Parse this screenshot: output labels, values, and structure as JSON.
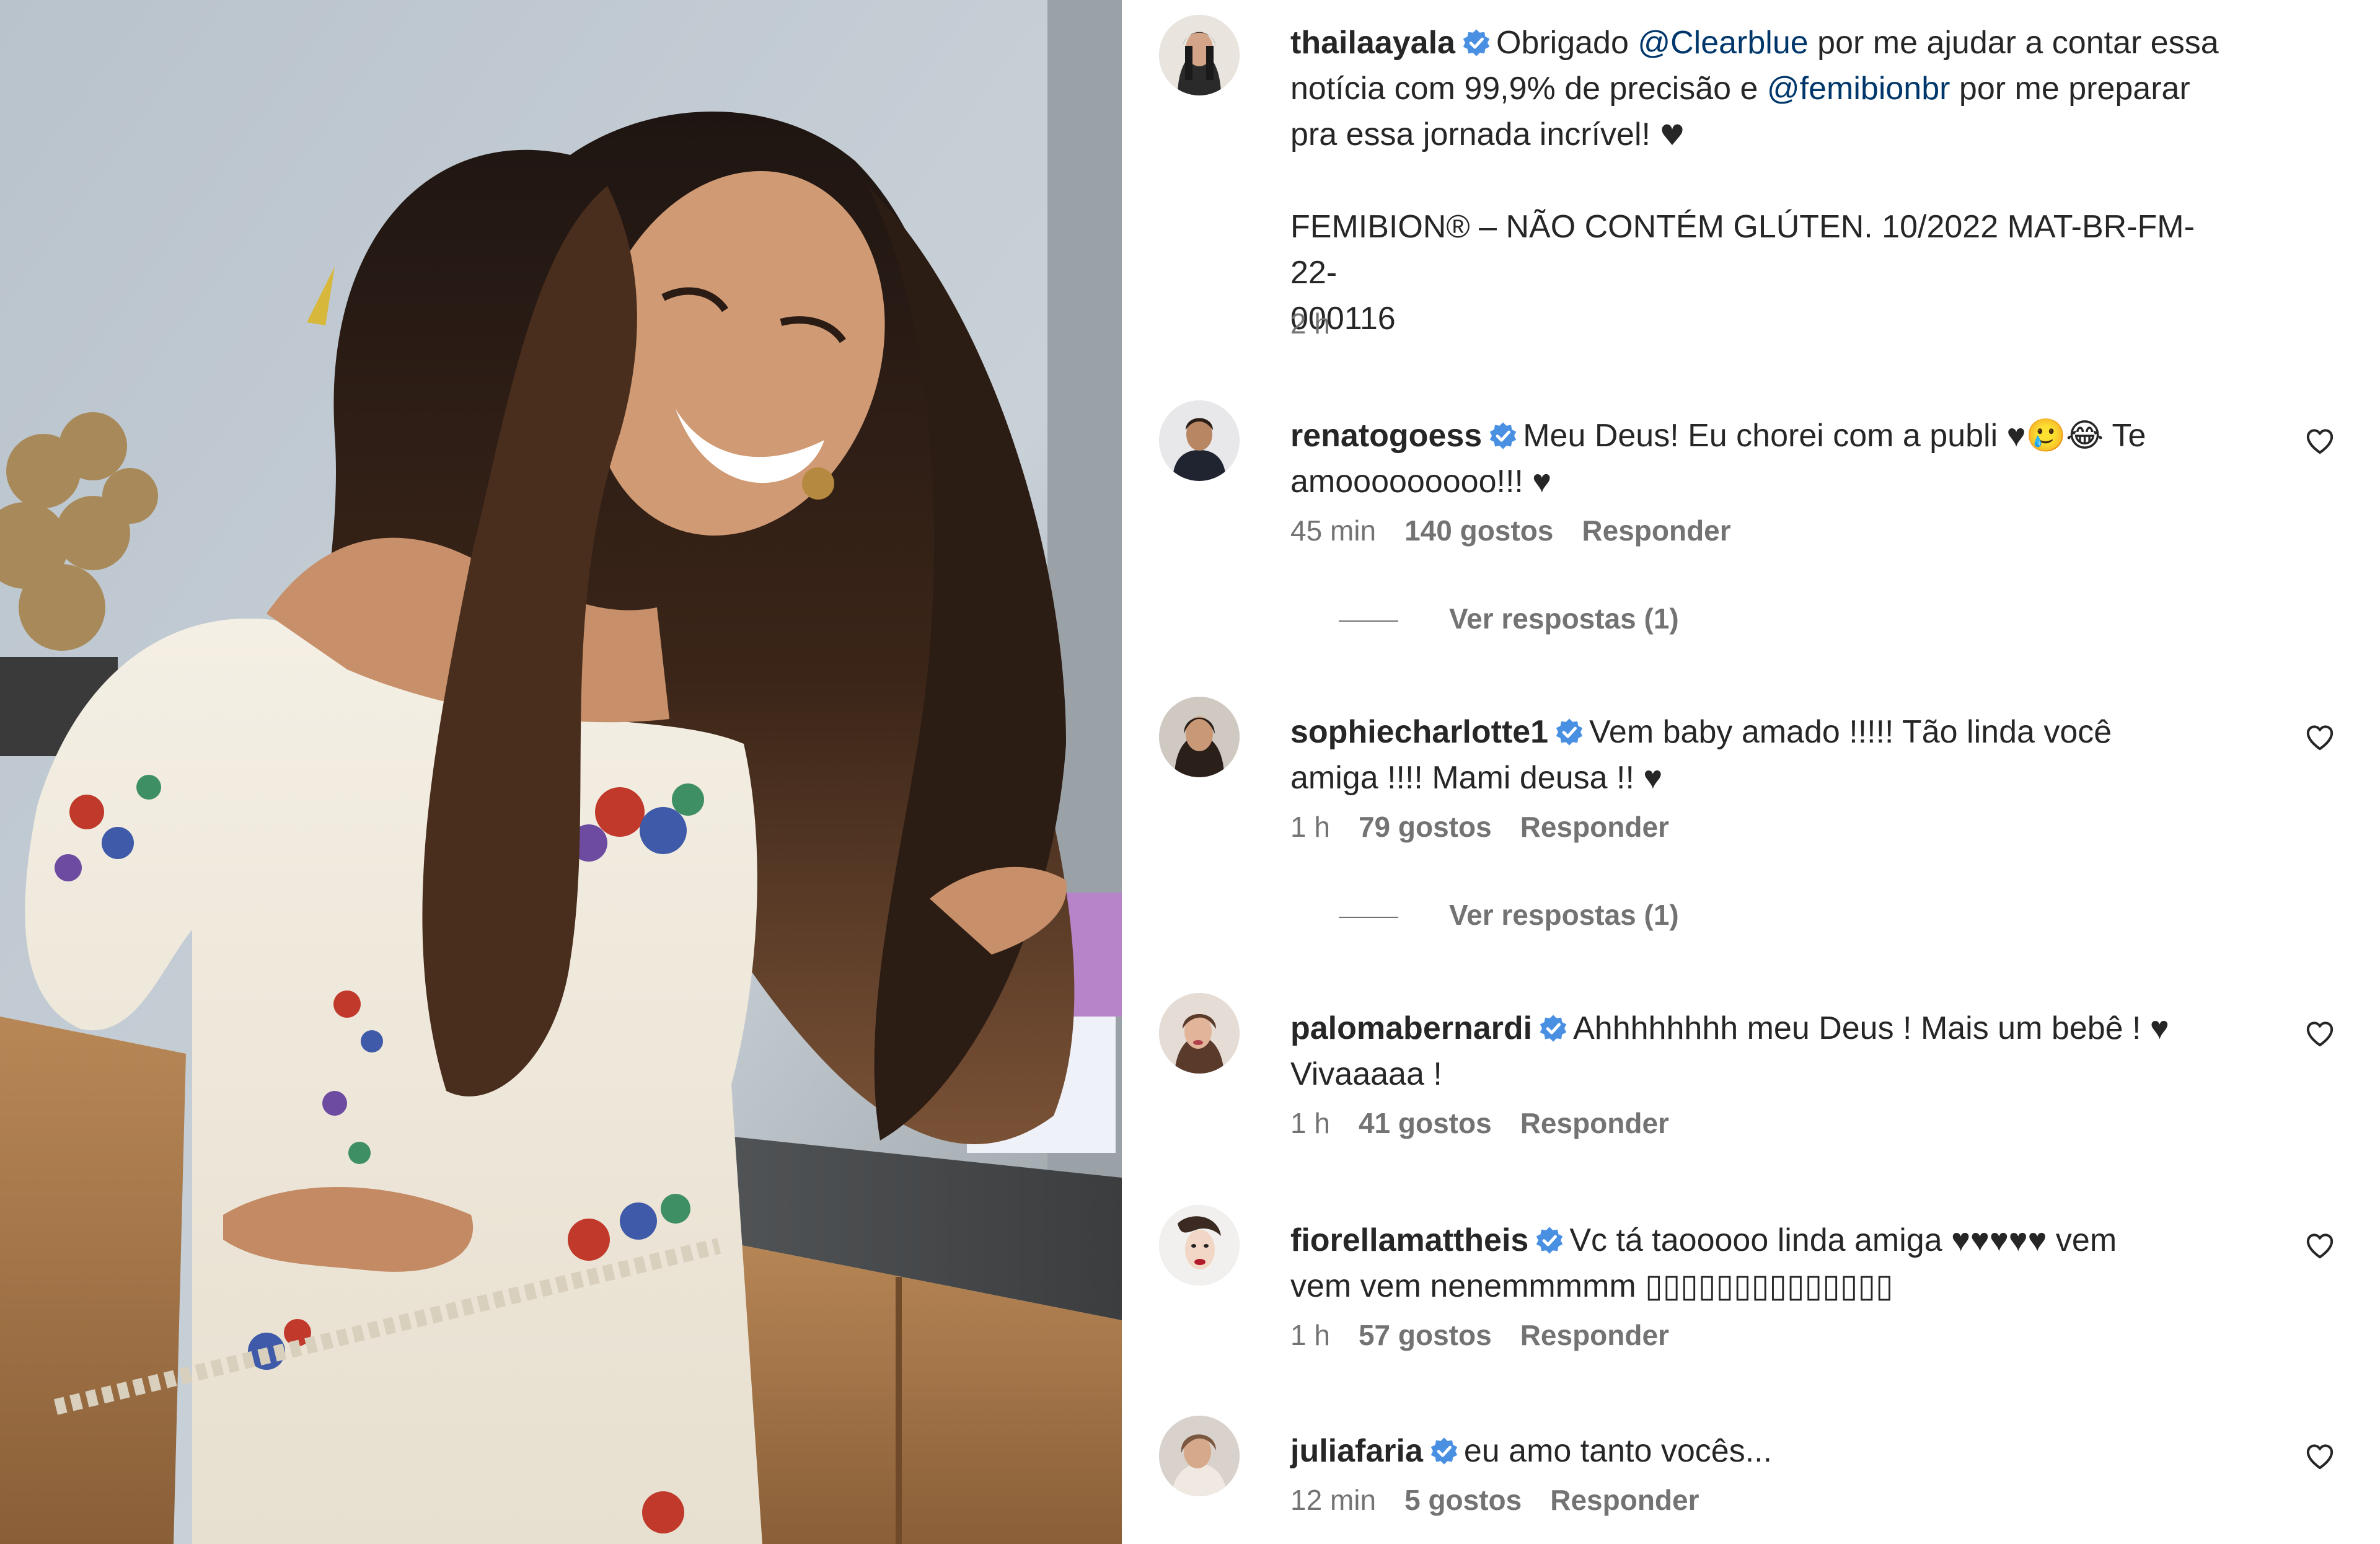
{
  "post": {
    "author": "thailaayala",
    "caption_lines": [
      {
        "parts": [
          {
            "t": "Obrigado ",
            "c": "text"
          },
          {
            "t": "@Clearblue",
            "c": "mention"
          },
          {
            "t": " por me ajudar a contar essa",
            "c": "text"
          }
        ]
      },
      {
        "parts": [
          {
            "t": "notícia com 99,9% de precisão e ",
            "c": "text"
          },
          {
            "t": "@femibionbr",
            "c": "mention"
          },
          {
            "t": " por me preparar",
            "c": "text"
          }
        ]
      },
      {
        "parts": [
          {
            "t": "pra essa jornada incrível! ",
            "c": "text"
          },
          {
            "t": "♥",
            "c": "heart"
          }
        ]
      }
    ],
    "disclaimer_lines": [
      "FEMIBION® – NÃO CONTÉM GLÚTEN. 10/2022 MAT-BR-FM-22-",
      "000116"
    ],
    "time": "2 h"
  },
  "comments": [
    {
      "username": "renatogoess",
      "lines": [
        "Meu Deus! Eu chorei com a publi ♥🥲😂 Te",
        "amooooooooo!!! ♥"
      ],
      "time": "45 min",
      "likes": "140 gostos",
      "reply": "Responder",
      "view_replies": "Ver respostas (1)"
    },
    {
      "username": "sophiecharlotte1",
      "lines": [
        "Vem baby amado !!!!! Tão linda você",
        "amiga !!!! Mami deusa !! ♥"
      ],
      "time": "1 h",
      "likes": "79 gostos",
      "reply": "Responder",
      "view_replies": "Ver respostas (1)"
    },
    {
      "username": "palomabernardi",
      "lines": [
        "Ahhhhhhhh meu Deus ! Mais um bebê ! ♥",
        "Vivaaaaa !"
      ],
      "time": "1 h",
      "likes": "41 gostos",
      "reply": "Responder"
    },
    {
      "username": "fiorellamattheis",
      "lines": [
        "Vc tá taooooo linda amiga ♥♥♥♥♥ vem",
        "vem vem nenemmmmm ▯▯▯▯▯▯▯▯▯▯▯▯▯▯"
      ],
      "time": "1 h",
      "likes": "57 gostos",
      "reply": "Responder"
    },
    {
      "username": "juliafaria",
      "lines": [
        "eu amo tanto vocês..."
      ],
      "time": "12 min",
      "likes": "5 gostos",
      "reply": "Responder"
    }
  ],
  "colors": {
    "mention": "#00376b",
    "verified": "#4a90e2",
    "meta_text": "#737373",
    "primary_text": "#262626"
  },
  "icons": {
    "verified": "verified-badge-icon",
    "like": "heart-outline-icon"
  }
}
